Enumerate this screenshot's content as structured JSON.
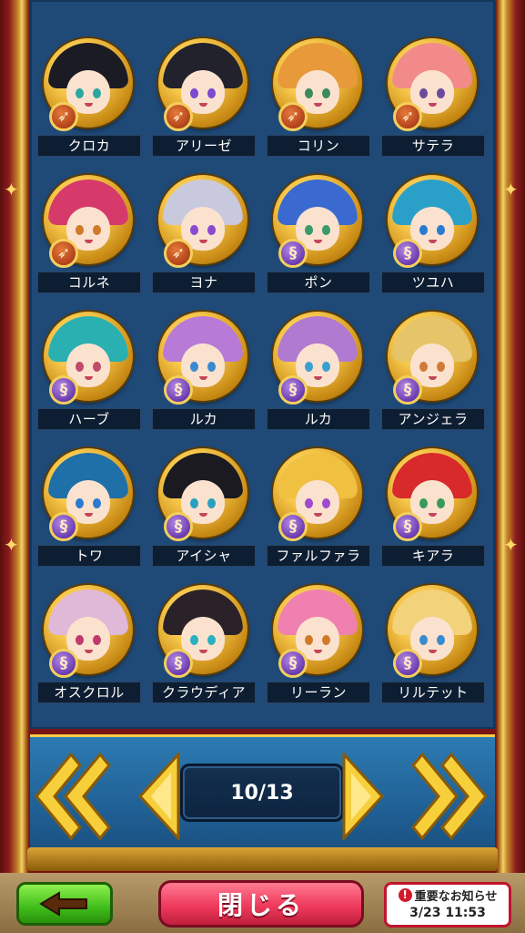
{
  "roster": [
    {
      "name": "クロカ",
      "class_icon": "bow-icon",
      "hair": "#1b1b24",
      "eyes": "#2aa7a0"
    },
    {
      "name": "アリーゼ",
      "class_icon": "bow-icon",
      "hair": "#22222c",
      "eyes": "#7a4ad0"
    },
    {
      "name": "コリン",
      "class_icon": "bow-icon",
      "hair": "#e89a3a",
      "eyes": "#3a8a5a"
    },
    {
      "name": "サテラ",
      "class_icon": "bow-icon",
      "hair": "#f28a8a",
      "eyes": "#6a4a9a"
    },
    {
      "name": "コルネ",
      "class_icon": "bow-icon",
      "hair": "#d63a6a",
      "eyes": "#d07a2a"
    },
    {
      "name": "ヨナ",
      "class_icon": "bow-icon",
      "hair": "#c9c9de",
      "eyes": "#8a4ad0"
    },
    {
      "name": "ポン",
      "class_icon": "magic-icon",
      "hair": "#3a6ad0",
      "eyes": "#3a9a6a"
    },
    {
      "name": "ツユハ",
      "class_icon": "magic-icon",
      "hair": "#2aa0c8",
      "eyes": "#2a7ad0"
    },
    {
      "name": "ハーブ",
      "class_icon": "magic-icon",
      "hair": "#2ab0b0",
      "eyes": "#c04a6a"
    },
    {
      "name": "ルカ",
      "class_icon": "magic-icon",
      "hair": "#b77ad6",
      "eyes": "#3a8ad0"
    },
    {
      "name": "ルカ",
      "class_icon": "magic-icon",
      "hair": "#b07ad0",
      "eyes": "#3aa0d0"
    },
    {
      "name": "アンジェラ",
      "class_icon": "magic-icon",
      "hair": "#e6c46a",
      "eyes": "#d07a3a"
    },
    {
      "name": "トワ",
      "class_icon": "magic-icon",
      "hair": "#1f6fa8",
      "eyes": "#2a7ad0"
    },
    {
      "name": "アイシャ",
      "class_icon": "magic-icon",
      "hair": "#1a1a20",
      "eyes": "#2aa0c0"
    },
    {
      "name": "ファルファラ",
      "class_icon": "magic-icon",
      "hair": "#f0c040",
      "eyes": "#a04ad0"
    },
    {
      "name": "キアラ",
      "class_icon": "magic-icon",
      "hair": "#d82a2a",
      "eyes": "#3a9a5a"
    },
    {
      "name": "オスクロル",
      "class_icon": "magic-icon",
      "hair": "#e0b8d8",
      "eyes": "#c03a6a"
    },
    {
      "name": "クラウディア",
      "class_icon": "magic-icon",
      "hair": "#2a2228",
      "eyes": "#2ab0c0"
    },
    {
      "name": "リーラン",
      "class_icon": "magic-icon",
      "hair": "#f080b0",
      "eyes": "#d07a2a"
    },
    {
      "name": "リルテット",
      "class_icon": "magic-icon",
      "hair": "#f2d27a",
      "eyes": "#3a8ad0"
    }
  ],
  "pager": {
    "label": "10/13"
  },
  "buttons": {
    "close_label": "閉じる"
  },
  "notice": {
    "title": "重要なお知らせ",
    "timestamp": "3/23 11:53"
  },
  "colors": {
    "panel": "#1f4a78",
    "frame_gold": "#f3d26a",
    "close_button": "#ef3a5c",
    "back_button": "#3fbd1a"
  }
}
